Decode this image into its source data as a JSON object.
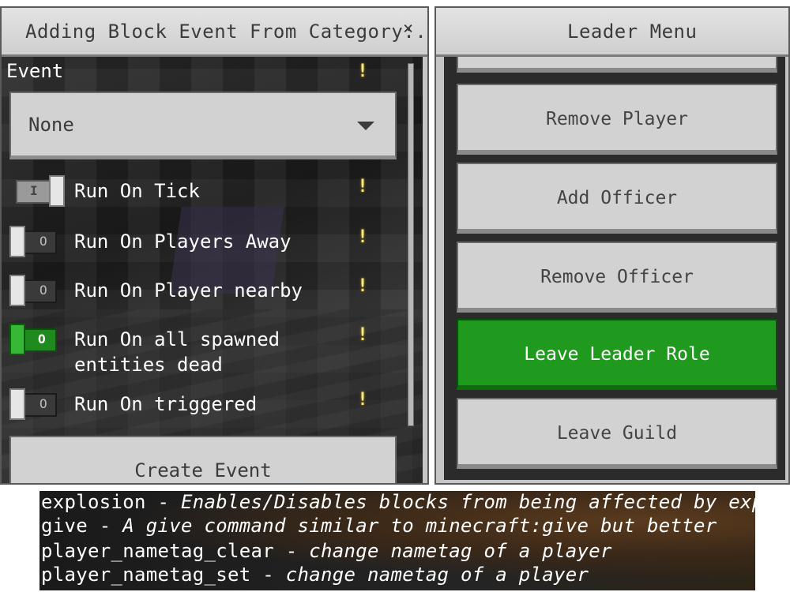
{
  "event_panel": {
    "title": "Adding Block Event From Category:...",
    "close": "×",
    "event_label": "Event",
    "dropdown_value": "None",
    "toggles": [
      {
        "label": "Run On Tick",
        "state": "tick"
      },
      {
        "label": "Run On Players Away",
        "state": "off"
      },
      {
        "label": "Run On Player nearby",
        "state": "off"
      },
      {
        "label": "Run On all spawned",
        "label2": "entities dead",
        "state": "on"
      },
      {
        "label": "Run On triggered",
        "state": "off"
      }
    ],
    "toggle_on_mark": "O",
    "toggle_off_mark": "O",
    "toggle_tick_mark": "I",
    "create_button": "Create Event"
  },
  "leader_menu": {
    "title": "Leader Menu",
    "close": "×",
    "buttons": [
      {
        "label": "Remove Player"
      },
      {
        "label": "Add Officer"
      },
      {
        "label": "Remove Officer"
      },
      {
        "label": "Leave Leader Role",
        "highlight": true
      },
      {
        "label": "Leave Guild"
      }
    ]
  },
  "console": {
    "lines": [
      {
        "cmd": "explosion",
        "desc": "Enables/Disables blocks from being affected by explosion"
      },
      {
        "cmd": "give",
        "desc": "A give command similar to minecraft:give but better"
      },
      {
        "cmd": "player_nametag_clear",
        "desc": "change nametag of a player"
      },
      {
        "cmd": "player_nametag_set",
        "desc": "change nametag of a player"
      }
    ],
    "separator": " - "
  },
  "colors": {
    "panel_gray": "#c6c6c6",
    "button_gray": "#d2d2d2",
    "accent_green": "#1f9a1f",
    "info_yellow": "#ffe97a"
  },
  "icons": [
    "info-icon",
    "chevron-down-icon",
    "close-icon"
  ]
}
